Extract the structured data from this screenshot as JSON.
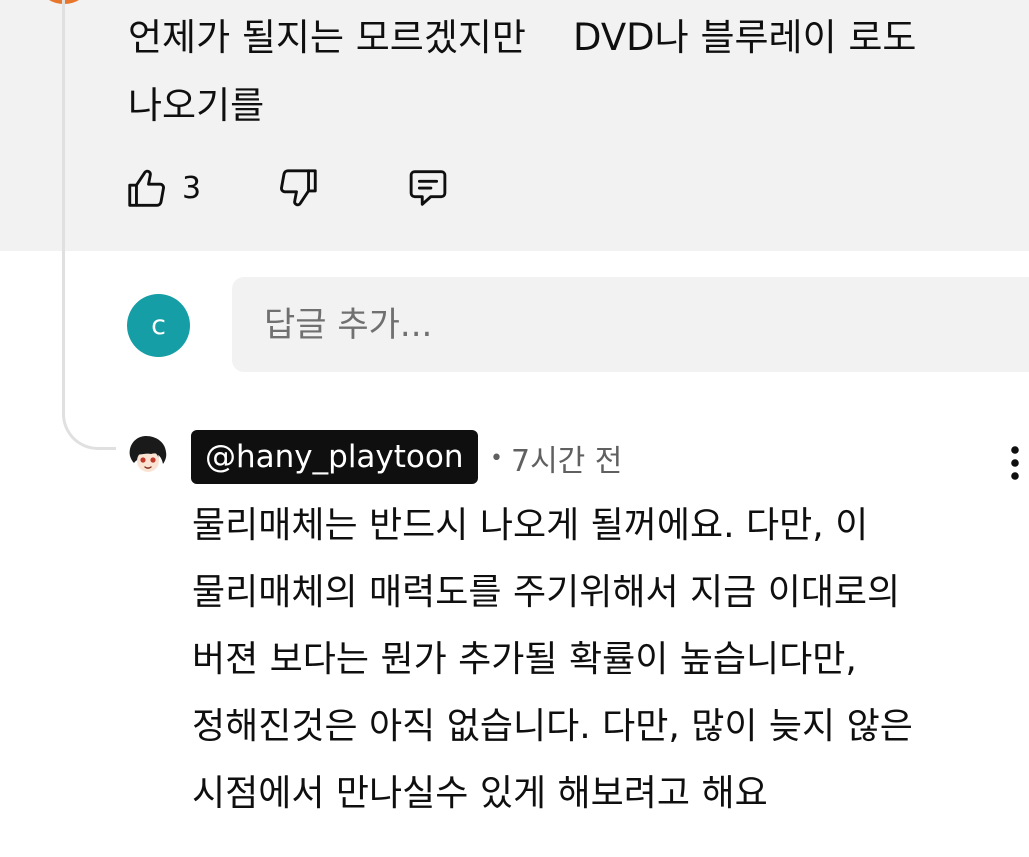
{
  "parent_comment": {
    "text_line1": "언제가 될지는 모르겠지만    DVD나 블루레이 로도",
    "text_line2": "나오기를",
    "like_count": "3",
    "avatar_color": "#e8772e"
  },
  "reply_box": {
    "avatar_letter": "c",
    "avatar_color": "#159ea6",
    "placeholder": "답글 추가..."
  },
  "creator_reply": {
    "author": "@hany_playtoon",
    "separator": "•",
    "time": "7시간 전",
    "lines": [
      "물리매체는 반드시 나오게 될꺼에요. 다만, 이",
      "물리매체의 매력도를 주기위해서 지금 이대로의",
      "버젼 보다는 뭔가 추가될 확률이 높습니다만,",
      "정해진것은 아직 없습니다. 다만, 많이 늦지 않은",
      "시점에서 만나실수 있게 해보려고 해요"
    ]
  },
  "icons": {
    "like": "thumbs-up-icon",
    "dislike": "thumbs-down-icon",
    "reply": "comment-icon",
    "more": "more-vert-icon"
  }
}
